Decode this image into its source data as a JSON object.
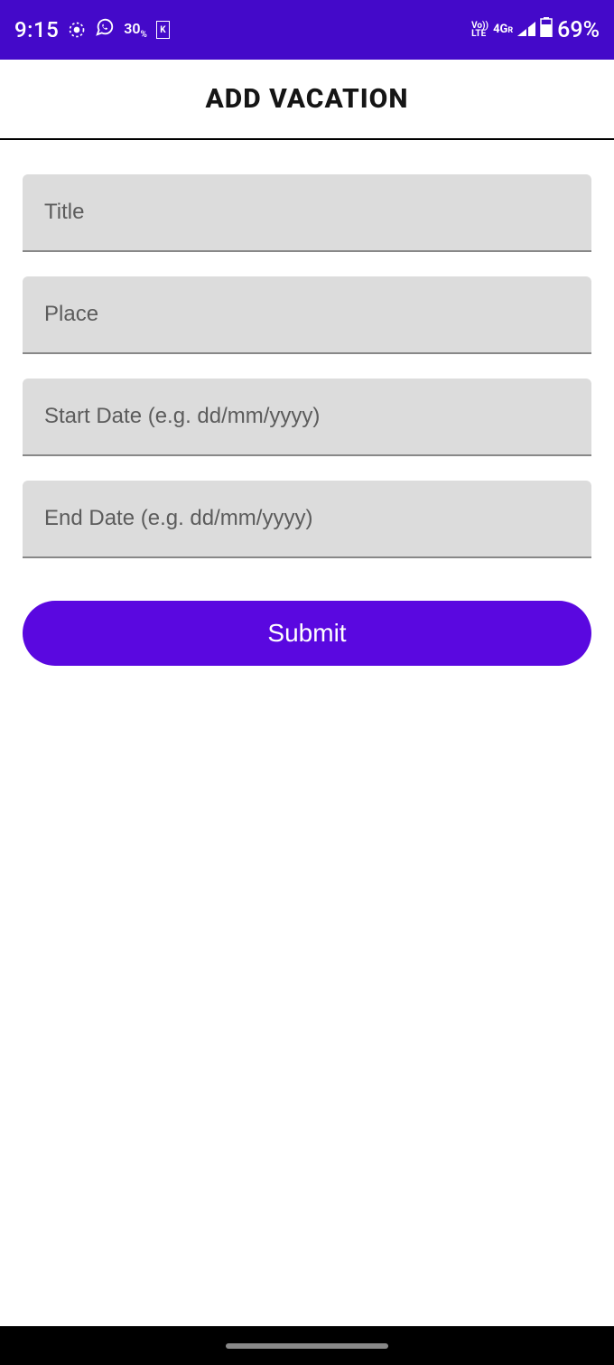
{
  "statusbar": {
    "time": "9:15",
    "notification_percent": "30",
    "notification_percent_suffix": "%",
    "battery_letter": "K",
    "volte_line1": "Vo))",
    "volte_line2": "LTE",
    "fourg": "4G",
    "fourg_suffix": "R",
    "battery_percent": "69%"
  },
  "header": {
    "title": "ADD VACATION"
  },
  "form": {
    "title": {
      "value": "",
      "placeholder": "Title"
    },
    "place": {
      "value": "",
      "placeholder": "Place"
    },
    "start_date": {
      "value": "",
      "placeholder": "Start Date (e.g. dd/mm/yyyy)"
    },
    "end_date": {
      "value": "",
      "placeholder": "End Date (e.g. dd/mm/yyyy)"
    },
    "submit_label": "Submit"
  }
}
